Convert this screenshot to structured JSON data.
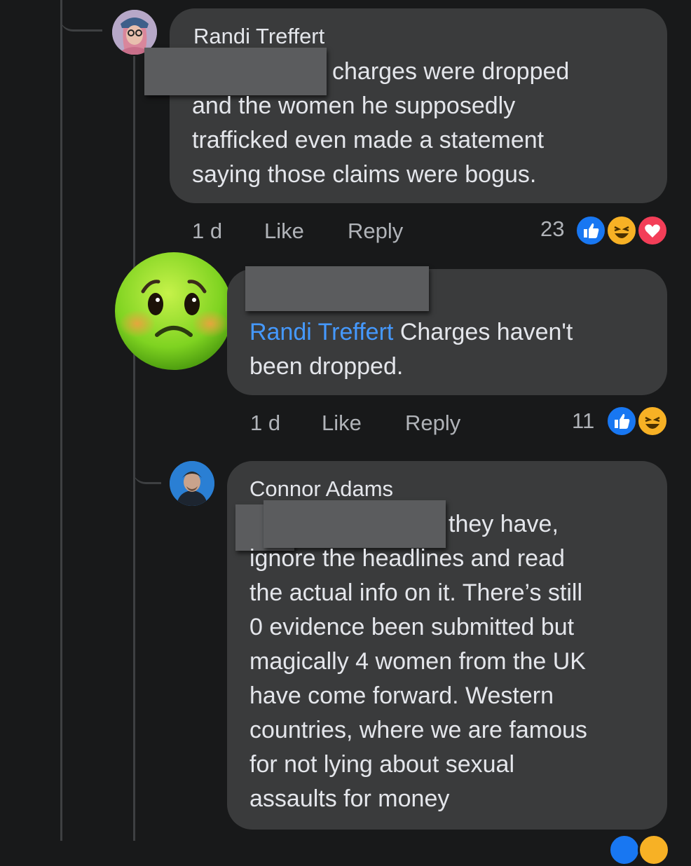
{
  "comments": [
    {
      "author": "Randi Treffert",
      "lines": [
        "charges were dropped",
        "and the women he supposedly",
        "trafficked even made a statement",
        "saying those claims were bogus."
      ],
      "time": "1 d",
      "like_label": "Like",
      "reply_label": "Reply",
      "reaction_count": "23",
      "reactions": [
        "like-icon",
        "haha-icon",
        "love-icon"
      ]
    },
    {
      "mention": "Randi Treffert",
      "line1_rest": " Charges haven't",
      "line2": "been dropped.",
      "time": "1 d",
      "like_label": "Like",
      "reply_label": "Reply",
      "reaction_count": "11",
      "reactions": [
        "like-icon",
        "haha-icon"
      ]
    },
    {
      "author": "Connor Adams",
      "lines": [
        "they have,",
        "ignore the headlines and read",
        "the actual info on it. There’s still",
        "0 evidence been submitted but",
        "magically 4 women from the UK",
        "have come forward. Western",
        "countries, where we are famous",
        "for not lying about sexual",
        "assaults for money"
      ]
    }
  ],
  "colors": {
    "background": "#18191a",
    "bubble": "#3a3b3c",
    "mention": "#4599ff",
    "like": "#1877f2",
    "love": "#f33e58",
    "haha": "#f7b125"
  }
}
